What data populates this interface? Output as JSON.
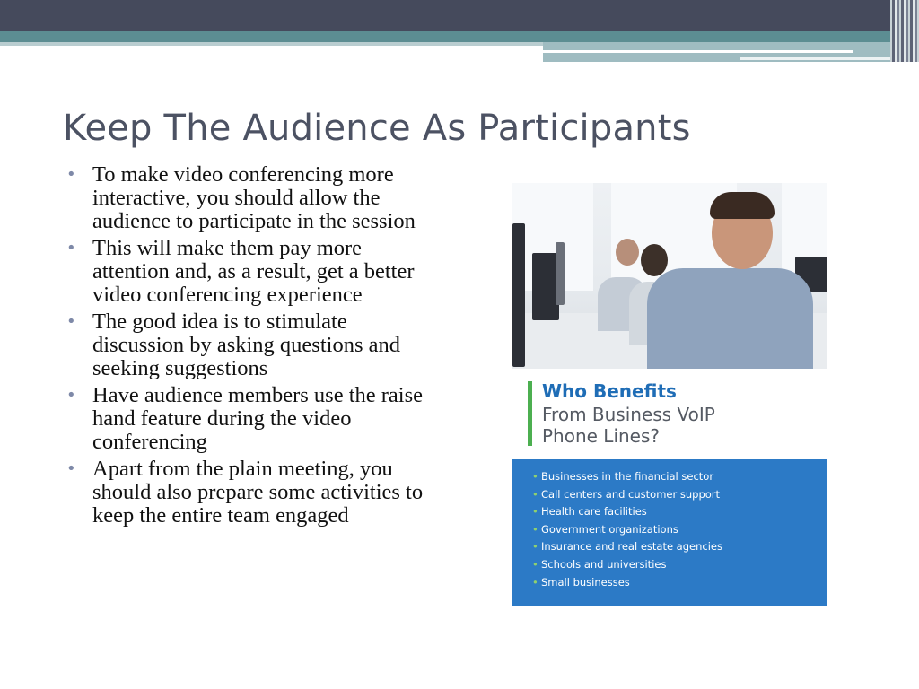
{
  "slide": {
    "title": "Keep The Audience As Participants",
    "bullets": [
      "To make video conferencing more interactive, you should allow the audience to participate in the session",
      "This will make them pay more attention and, as a result, get a better video conferencing experience",
      "The good idea is to stimulate discussion by asking questions and seeking suggestions",
      "Have audience members use the raise hand feature during the video conferencing",
      "Apart from the plain meeting, you should also prepare some activities to keep the entire team engaged"
    ]
  },
  "image": {
    "heading_bold": "Who Benefits",
    "heading_line2": "From Business VoIP",
    "heading_line3": "Phone Lines?",
    "benefits": [
      "Businesses in the financial sector",
      "Call centers and customer support",
      "Health care facilities",
      "Government organizations",
      "Insurance and real estate agencies",
      "Schools and universities",
      "Small businesses"
    ]
  },
  "colors": {
    "header_dark": "#454a5c",
    "header_teal": "#5c8d92",
    "title_text": "#4c5263",
    "bullet_mark": "#7e89a8",
    "heading_blue": "#1f6db6",
    "accent_green": "#4caf50",
    "box_blue": "#2c7ac6"
  }
}
